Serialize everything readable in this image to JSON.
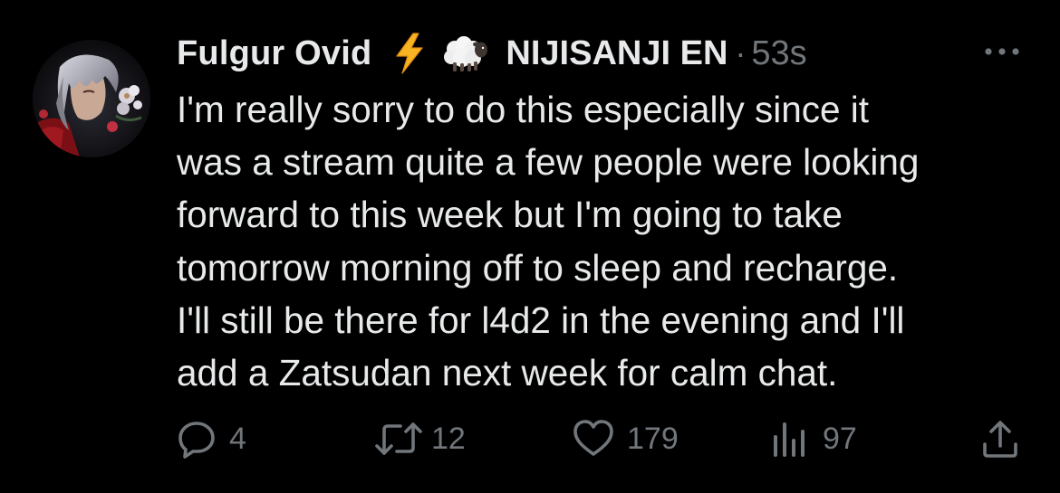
{
  "author": {
    "display_name": "Fulgur Ovid",
    "affiliation": "NIJISANJI EN",
    "separator": "·",
    "timestamp": "53s",
    "name_emojis": [
      "high-voltage-emoji",
      "sheep-emoji"
    ]
  },
  "tweet": {
    "text_lines": [
      "I'm really sorry to do this especially since it",
      "was a stream quite a few people were looking",
      "forward to this week but I'm going to take",
      "tomorrow morning off to sleep and recharge.",
      "I'll still be there for l4d2 in the evening and I'll",
      "add a Zatsudan next week for calm chat."
    ]
  },
  "actions": {
    "replies": "4",
    "retweets": "12",
    "likes": "179",
    "views": "97"
  },
  "icons": {
    "more": "more-horizontal-icon",
    "reply": "reply-icon",
    "retweet": "retweet-icon",
    "like": "heart-icon",
    "views": "views-chart-icon",
    "share": "share-icon"
  },
  "colors": {
    "background": "#000000",
    "primary_text": "#e7e9ea",
    "secondary_text": "#71767b"
  }
}
